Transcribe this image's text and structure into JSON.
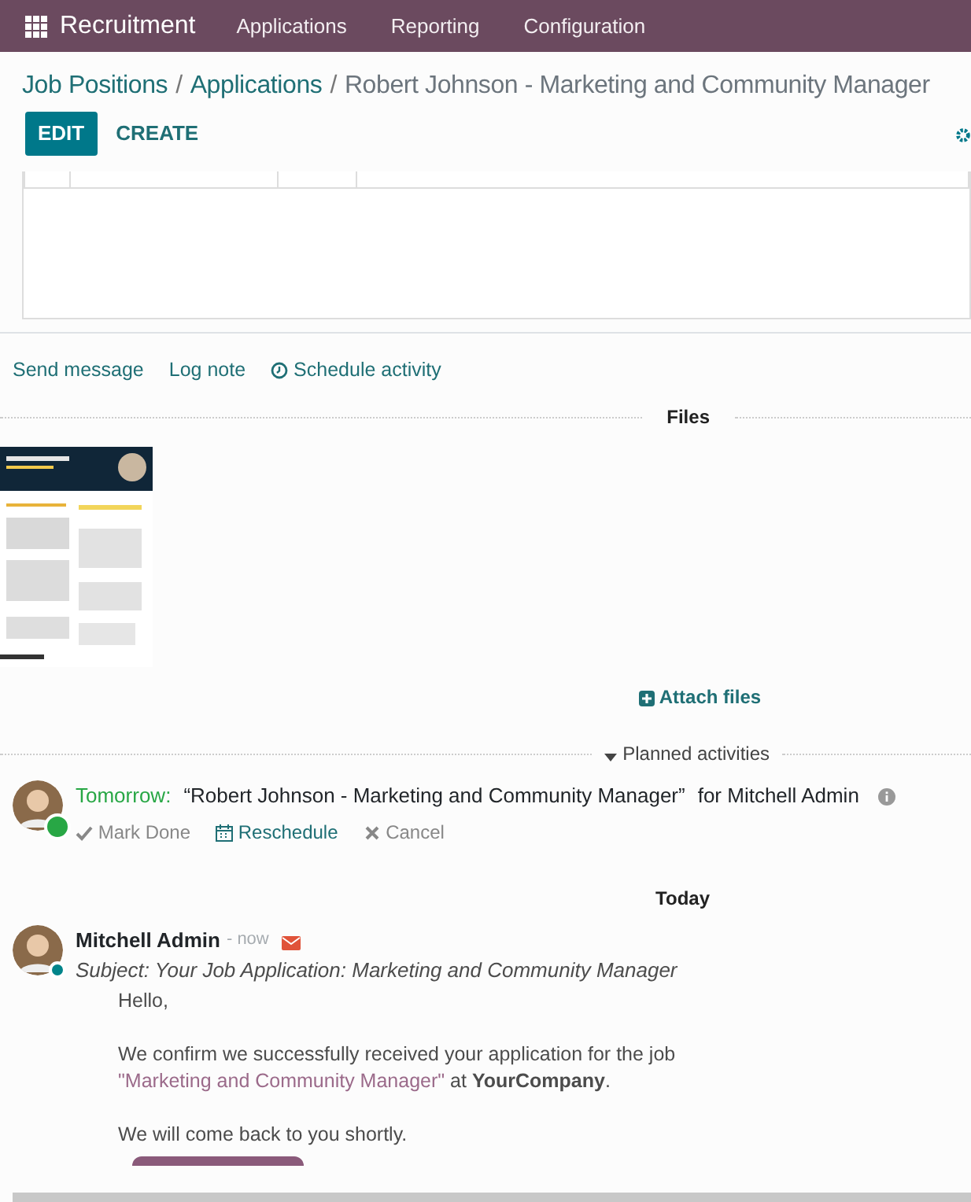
{
  "navbar": {
    "app_name": "Recruitment",
    "menu": [
      "Applications",
      "Reporting",
      "Configuration"
    ]
  },
  "breadcrumb": [
    {
      "label": "Job Positions",
      "link": true
    },
    {
      "separator": "/",
      "label": "Applications",
      "link": true
    },
    {
      "separator": "/",
      "label": "Robert Johnson - Marketing and Community Manager",
      "link": false
    }
  ],
  "buttons": [
    {
      "label": "EDIT",
      "kind": "primary"
    },
    {
      "label": "CREATE",
      "kind": "secondary"
    }
  ],
  "chatter_actions": [
    {
      "label": "Send message",
      "kind": "plain"
    },
    {
      "label": "Log note",
      "kind": "plain"
    },
    {
      "label": "Schedule activity",
      "kind": "clock"
    }
  ],
  "files": {
    "title": "Files",
    "attach_label": "Attach files"
  },
  "planned": {
    "title": "Planned activities",
    "expanded": true,
    "activities": [
      {
        "due": "Tomorrow:",
        "summary": "“Robert Johnson - Marketing and Community Manager”",
        "assigned": "for Mitchell Admin",
        "actions": [
          {
            "label": "Mark Done",
            "kind": "check"
          },
          {
            "label": "Reschedule",
            "kind": "calendar"
          },
          {
            "label": "Cancel",
            "kind": "cancel"
          }
        ]
      }
    ]
  },
  "date_separator": "Today",
  "messages": [
    {
      "author": "Mitchell Admin",
      "time": "- now",
      "online": true,
      "subject": "Subject: Your Job Application: Marketing and Community Manager",
      "body": [
        {
          "text": "Hello,"
        },
        {
          "text": "We confirm we successfully received your application for the job ",
          "link": "\"Marketing and Community Manager\"",
          "after": " at **YourCompany**."
        },
        {
          "text": "We will come back to you shortly."
        }
      ]
    }
  ]
}
